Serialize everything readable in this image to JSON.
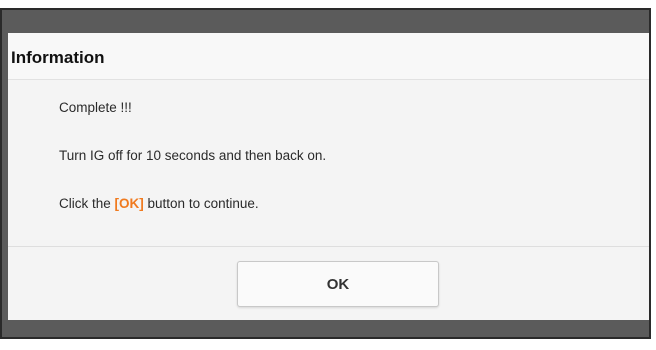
{
  "dialog": {
    "title": "Information",
    "messages": {
      "line1": "Complete !!!",
      "line2": "Turn IG off for 10 seconds and then back on.",
      "line3_prefix": "Click the ",
      "line3_highlight": "[OK]",
      "line3_suffix": " button to continue."
    },
    "ok_button_label": "OK"
  },
  "colors": {
    "highlight": "#f07a1f",
    "frame": "#5b5b5b",
    "dialog_background": "#f4f4f4"
  }
}
